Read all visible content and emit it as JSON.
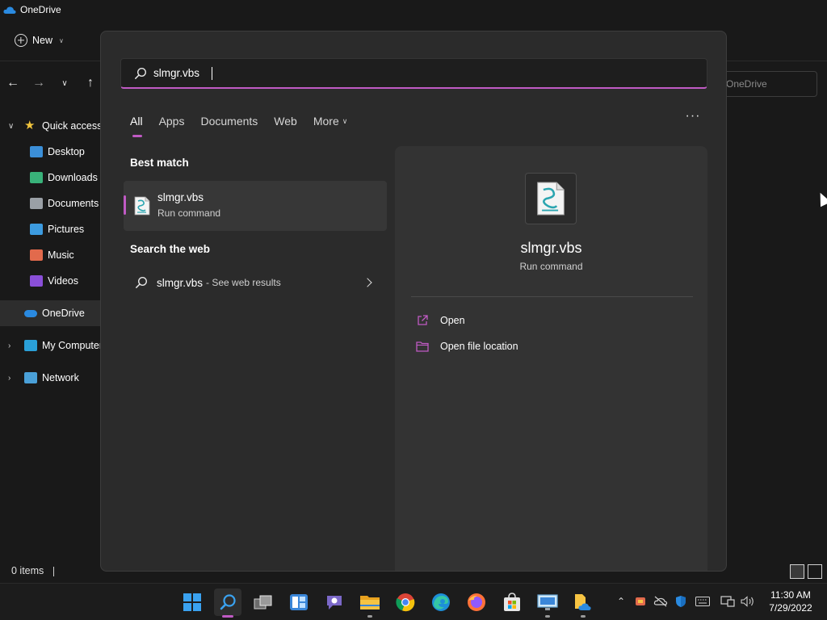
{
  "explorer": {
    "title": "OneDrive",
    "new_label": "New",
    "address_text": "OneDrive",
    "tree": [
      {
        "label": "Quick access",
        "level": 1,
        "icon": "star-icon",
        "color": "#f2c53d",
        "expander": "∨"
      },
      {
        "label": "Desktop",
        "level": 2,
        "icon": "desktop-folder-icon",
        "color": "#3b8fd8"
      },
      {
        "label": "Downloads",
        "level": 2,
        "icon": "download-folder-icon",
        "color": "#39b27a"
      },
      {
        "label": "Documents",
        "level": 2,
        "icon": "documents-folder-icon",
        "color": "#9aa0a6"
      },
      {
        "label": "Pictures",
        "level": 2,
        "icon": "pictures-folder-icon",
        "color": "#3c9be0"
      },
      {
        "label": "Music",
        "level": 2,
        "icon": "music-folder-icon",
        "color": "#e26a4c"
      },
      {
        "label": "Videos",
        "level": 2,
        "icon": "videos-folder-icon",
        "color": "#8a4fd8"
      },
      {
        "label": "OneDrive",
        "level": 1,
        "icon": "onedrive-cloud-icon",
        "color": "#2a8ae0",
        "selected": true
      },
      {
        "label": "My Computer",
        "level": 1,
        "icon": "computer-icon",
        "color": "#2aa0d8",
        "expander": "›"
      },
      {
        "label": "Network",
        "level": 1,
        "icon": "network-icon",
        "color": "#4aa0d8",
        "expander": "›"
      }
    ],
    "status_items": "0 items"
  },
  "search": {
    "query": "slmgr.vbs",
    "tabs": [
      {
        "label": "All",
        "active": true
      },
      {
        "label": "Apps"
      },
      {
        "label": "Documents"
      },
      {
        "label": "Web"
      },
      {
        "label": "More",
        "dropdown": true
      }
    ],
    "more_options_label": "···",
    "best_match_heading": "Best match",
    "best_match": {
      "name": "slmgr.vbs",
      "subtitle": "Run command"
    },
    "web_heading": "Search the web",
    "web_result": {
      "query": "slmgr.vbs",
      "suffix": "- See web results"
    },
    "preview": {
      "name": "slmgr.vbs",
      "subtitle": "Run command",
      "actions": [
        {
          "label": "Open",
          "icon": "open-external-icon"
        },
        {
          "label": "Open file location",
          "icon": "folder-icon"
        }
      ]
    },
    "accent_color": "#c05ac4"
  },
  "taskbar": {
    "apps": [
      "windows-start-icon",
      "search-icon",
      "task-view-icon",
      "widgets-icon",
      "teams-chat-icon",
      "file-explorer-icon",
      "chrome-icon",
      "edge-icon",
      "firefox-icon",
      "microsoft-store-icon",
      "remote-desktop-icon",
      "onedrive-folder-icon"
    ],
    "time": "11:30 AM",
    "date": "7/29/2022"
  }
}
